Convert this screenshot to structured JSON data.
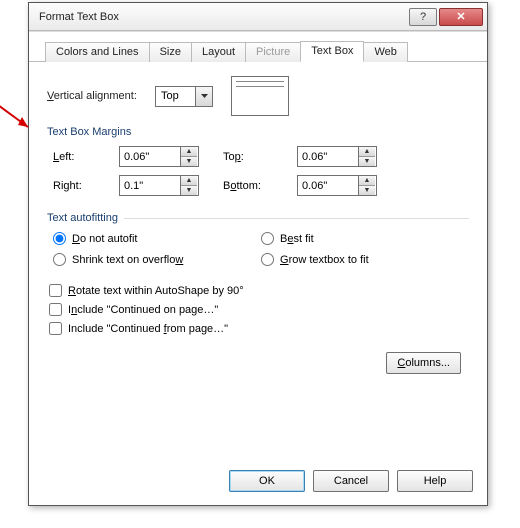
{
  "title": "Format Text Box",
  "tabs": {
    "colors": "Colors and Lines",
    "size": "Size",
    "layout": "Layout",
    "picture": "Picture",
    "textbox": "Text Box",
    "web": "Web"
  },
  "valign": {
    "label": "Vertical alignment:",
    "value": "Top"
  },
  "group_margins": "Text Box Margins",
  "margins": {
    "left_label": "Left:",
    "left": "0.06\"",
    "right_label": "Right:",
    "right": "0.1\"",
    "top_label": "Top:",
    "top": "0.06\"",
    "bottom_label": "Bottom:",
    "bottom": "0.06\""
  },
  "group_autofit": "Text autofitting",
  "autofit": {
    "no": "Do not autofit",
    "shrink": "Shrink text on overflow",
    "best": "Best fit",
    "grow": "Grow textbox to fit"
  },
  "checks": {
    "rotate": "Rotate text within AutoShape by 90°",
    "cont_on": "Include \"Continued on page…\"",
    "cont_from": "Include \"Continued from page…\""
  },
  "columns_btn": "Columns...",
  "buttons": {
    "ok": "OK",
    "cancel": "Cancel",
    "help": "Help"
  },
  "arrow_color": "#d40000"
}
